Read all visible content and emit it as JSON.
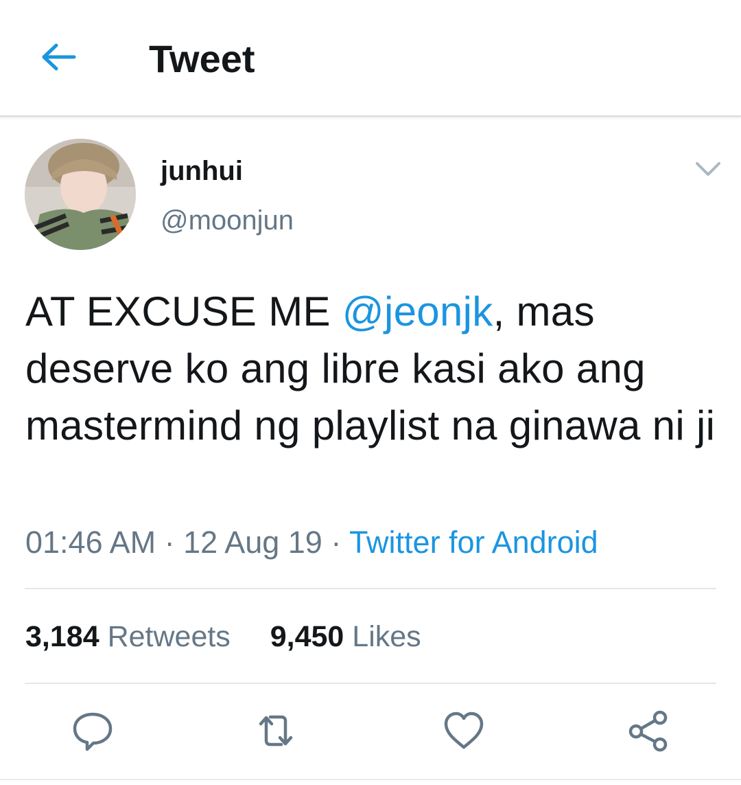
{
  "header": {
    "title": "Tweet",
    "back_icon": "arrow-left-icon"
  },
  "tweet": {
    "user": {
      "name": "junhui",
      "handle": "@moonjun"
    },
    "text_before": "AT EXCUSE ME ",
    "mention": "@jeonjk",
    "text_after": ", mas deserve ko ang libre kasi ako ang mastermind ng playlist na ginawa ni ji",
    "time": "01:46 AM",
    "separator": " · ",
    "date": "12 Aug 19",
    "source": "Twitter for Android"
  },
  "stats": {
    "retweets_count": "3,184",
    "retweets_label": "Retweets",
    "likes_count": "9,450",
    "likes_label": "Likes"
  },
  "actions": [
    "reply-icon",
    "retweet-icon",
    "like-icon",
    "share-icon"
  ],
  "colors": {
    "accent": "#1b95e0",
    "text": "#14171a",
    "muted": "#657786",
    "icon": "#657786"
  }
}
